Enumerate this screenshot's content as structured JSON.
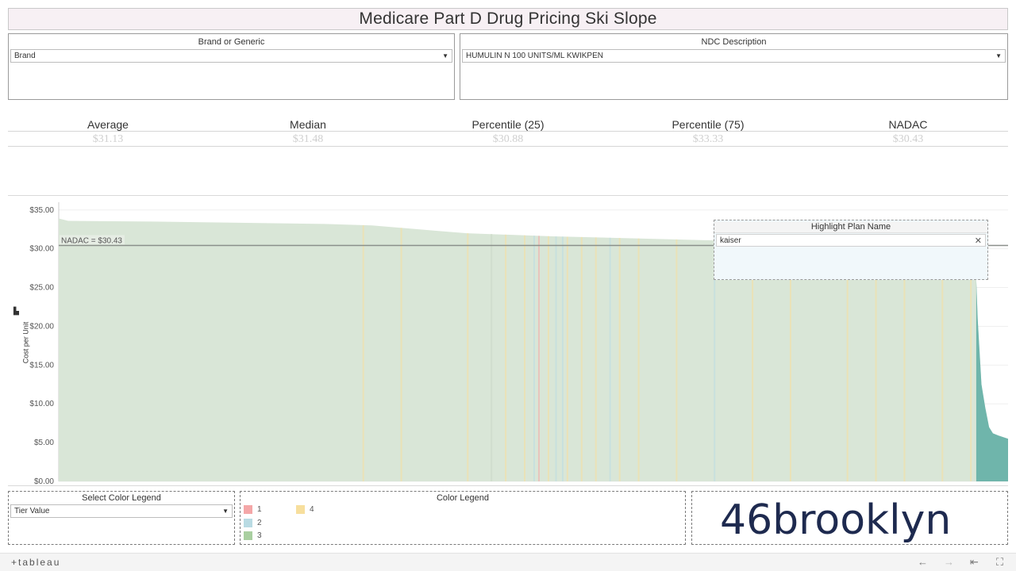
{
  "title": "Medicare Part D Drug Pricing Ski Slope",
  "filters": {
    "brand_generic": {
      "label": "Brand or Generic",
      "value": "Brand"
    },
    "ndc": {
      "label": "NDC Description",
      "value": "HUMULIN N 100 UNITS/ML KWIKPEN"
    }
  },
  "stats": [
    {
      "label": "Average",
      "value": "$31.13"
    },
    {
      "label": "Median",
      "value": "$31.48"
    },
    {
      "label": "Percentile (25)",
      "value": "$30.88"
    },
    {
      "label": "Percentile (75)",
      "value": "$33.33"
    },
    {
      "label": "NADAC",
      "value": "$30.43"
    }
  ],
  "chart_data": {
    "type": "bar",
    "ylabel": "Cost per Unit",
    "ylim": [
      0,
      36
    ],
    "yticks": [
      "$0.00",
      "$5.00",
      "$10.00",
      "$15.00",
      "$20.00",
      "$25.00",
      "$30.00",
      "$35.00"
    ],
    "reference_line": {
      "label": "NADAC = $30.43",
      "value": 30.43
    },
    "curve_points": [
      [
        0,
        33.9
      ],
      [
        0.01,
        33.6
      ],
      [
        0.1,
        33.5
      ],
      [
        0.16,
        33.4
      ],
      [
        0.28,
        33.2
      ],
      [
        0.33,
        33.0
      ],
      [
        0.4,
        32.3
      ],
      [
        0.43,
        32.0
      ],
      [
        0.52,
        31.6
      ],
      [
        0.62,
        31.3
      ],
      [
        0.68,
        31.1
      ],
      [
        0.8,
        30.9
      ],
      [
        0.9,
        30.5
      ],
      [
        0.965,
        30.0
      ],
      [
        0.9665,
        26.0
      ],
      [
        0.968,
        21.0
      ],
      [
        0.972,
        12.5
      ],
      [
        0.976,
        9.5
      ],
      [
        0.98,
        7.0
      ],
      [
        0.984,
        6.2
      ],
      [
        0.99,
        5.9
      ],
      [
        1.0,
        5.5
      ]
    ],
    "highlight_series_color": "#6fb5ab",
    "base_fill_color": "#d9e6d7",
    "tier_stripes": [
      {
        "x": 0.32,
        "tier": 4
      },
      {
        "x": 0.36,
        "tier": 4
      },
      {
        "x": 0.43,
        "tier": 4
      },
      {
        "x": 0.455,
        "tier": 4
      },
      {
        "x": 0.455,
        "tier": 2
      },
      {
        "x": 0.47,
        "tier": 4
      },
      {
        "x": 0.49,
        "tier": 4
      },
      {
        "x": 0.5,
        "tier": 2
      },
      {
        "x": 0.505,
        "tier": 1
      },
      {
        "x": 0.515,
        "tier": 4
      },
      {
        "x": 0.523,
        "tier": 2
      },
      {
        "x": 0.53,
        "tier": 2
      },
      {
        "x": 0.535,
        "tier": 4
      },
      {
        "x": 0.55,
        "tier": 4
      },
      {
        "x": 0.565,
        "tier": 4
      },
      {
        "x": 0.58,
        "tier": 2
      },
      {
        "x": 0.59,
        "tier": 4
      },
      {
        "x": 0.61,
        "tier": 4
      },
      {
        "x": 0.65,
        "tier": 4
      },
      {
        "x": 0.69,
        "tier": 2
      },
      {
        "x": 0.73,
        "tier": 4
      },
      {
        "x": 0.77,
        "tier": 4
      },
      {
        "x": 0.83,
        "tier": 4
      },
      {
        "x": 0.86,
        "tier": 4
      },
      {
        "x": 0.89,
        "tier": 4
      },
      {
        "x": 0.93,
        "tier": 4
      },
      {
        "x": 0.96,
        "tier": 4
      }
    ]
  },
  "highlight": {
    "label": "Highlight Plan Name",
    "value": "kaiser"
  },
  "color_select": {
    "label": "Select Color Legend",
    "value": "Tier Value"
  },
  "color_legend": {
    "label": "Color Legend",
    "items": [
      {
        "name": "1",
        "color": "#f4a7a8"
      },
      {
        "name": "2",
        "color": "#b9dbe3"
      },
      {
        "name": "3",
        "color": "#a9cfa0"
      },
      {
        "name": "4",
        "color": "#f7df9d"
      }
    ]
  },
  "logo_text": "46brooklyn",
  "footer_brand": "+tableau"
}
